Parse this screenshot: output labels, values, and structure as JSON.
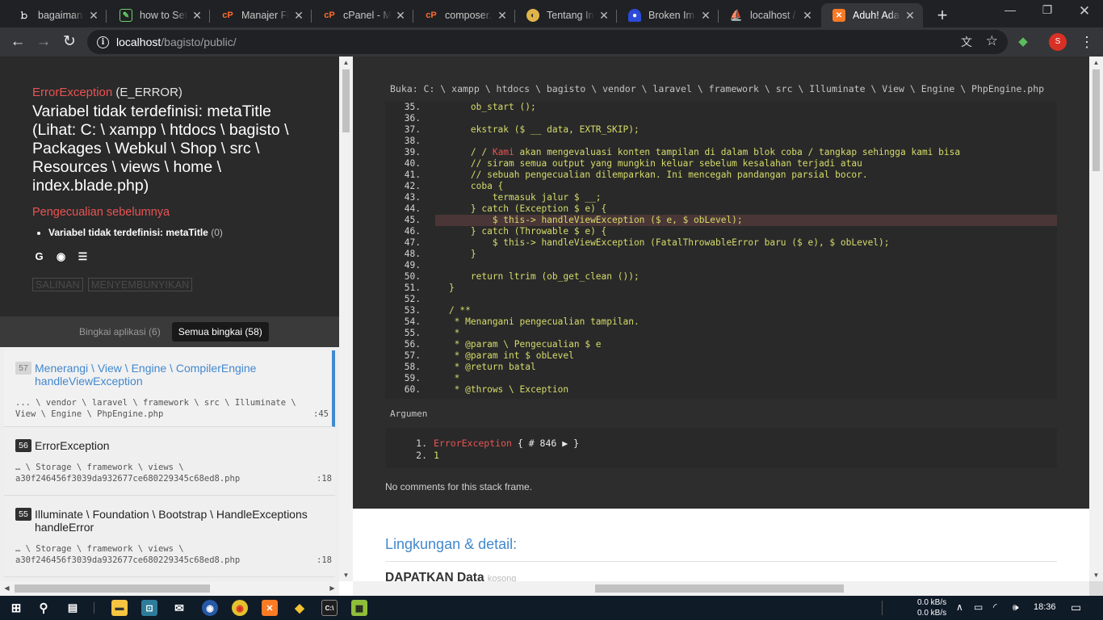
{
  "browser": {
    "tabs": [
      {
        "title": "bagaimana",
        "icon": "bing-icon"
      },
      {
        "title": "how to Setup",
        "icon": "document-icon"
      },
      {
        "title": "Manajer File",
        "icon": "cpanel-icon"
      },
      {
        "title": "cPanel - Ma",
        "icon": "cpanel-icon"
      },
      {
        "title": "composer.js",
        "icon": "cpanel-icon"
      },
      {
        "title": "Tentang Ind",
        "icon": "globe-icon"
      },
      {
        "title": "Broken Ima",
        "icon": "user-icon"
      },
      {
        "title": "localhost /",
        "icon": "phpmyadmin-icon"
      },
      {
        "title": "Aduh! Ada k",
        "icon": "xampp-icon",
        "active": true
      }
    ],
    "new_tab": "+",
    "url_host": "localhost",
    "url_path": "/bagisto/public/",
    "profile_initial": "S"
  },
  "exception": {
    "class_label": "ErrorException",
    "class_code": "(E_ERROR)",
    "message": "Variabel tidak terdefinisi: metaTitle (Lihat: C: \\ xampp \\ htdocs \\ bagisto \\ Packages \\ Webkul \\ Shop \\ src \\ Resources \\ views \\ home \\ index.blade.php)",
    "previous_title": "Pengecualian sebelumnya",
    "previous_item": "Variabel tidak terdefinisi: metaTitle",
    "previous_code": "(0)",
    "copy_button": "SALINAN",
    "hide_button": "MENYEMBUNYIKAN"
  },
  "frame_tabs": {
    "app": "Bingkai aplikasi (6)",
    "all": "Semua bingkai (58)"
  },
  "frames": [
    {
      "num": "57",
      "class": "Menerangi \\ View \\ Engine \\ CompilerEngine handleViewException",
      "file": "... \\ vendor \\ laravel \\ framework \\ src \\ Illuminate \\ View \\ Engine \\ PhpEngine.php",
      "line": ":45",
      "active": true
    },
    {
      "num": "56",
      "class": "ErrorException",
      "file": "… \\ Storage \\ framework \\ views \\ a30f246456f3039da932677ce680229345c68ed8.php",
      "line": ":18"
    },
    {
      "num": "55",
      "class": "Illuminate \\ Foundation \\ Bootstrap \\ HandleExceptions handleError",
      "file": "… \\ Storage \\ framework \\ views \\ a30f246456f3039da932677ce680229345c68ed8.php",
      "line": ":18"
    }
  ],
  "code": {
    "file_path": "Buka: C: \\ xampp \\ htdocs \\ bagisto \\ vendor \\ laravel \\ framework \\ src \\ Illuminate \\ View \\ Engine \\ PhpEngine.php",
    "lines": [
      {
        "n": "35.",
        "t": "        ob_start ();"
      },
      {
        "n": "36.",
        "t": ""
      },
      {
        "n": "37.",
        "t": "        ekstrak ($ __ data, EXTR_SKIP);"
      },
      {
        "n": "38.",
        "t": ""
      },
      {
        "n": "39.",
        "t": "        / / Kami akan mengevaluasi konten tampilan di dalam blok coba / tangkap sehingga kami bisa"
      },
      {
        "n": "40.",
        "t": "        // siram semua output yang mungkin keluar sebelum kesalahan terjadi atau"
      },
      {
        "n": "41.",
        "t": "        // sebuah pengecualian dilemparkan. Ini mencegah pandangan parsial bocor."
      },
      {
        "n": "42.",
        "t": "        coba {"
      },
      {
        "n": "43.",
        "t": "            termasuk jalur $ __;"
      },
      {
        "n": "44.",
        "t": "        } catch (Exception $ e) {"
      },
      {
        "n": "45.",
        "t": "            $ this-> handleViewException ($ e, $ obLevel);",
        "hl": true
      },
      {
        "n": "46.",
        "t": "        } catch (Throwable $ e) {"
      },
      {
        "n": "47.",
        "t": "            $ this-> handleViewException (FatalThrowableError baru ($ e), $ obLevel);"
      },
      {
        "n": "48.",
        "t": "        }"
      },
      {
        "n": "49.",
        "t": ""
      },
      {
        "n": "50.",
        "t": "        return ltrim (ob_get_clean ());"
      },
      {
        "n": "51.",
        "t": "    }"
      },
      {
        "n": "52.",
        "t": ""
      },
      {
        "n": "53.",
        "t": "    / **"
      },
      {
        "n": "54.",
        "t": "     * Menangani pengecualian tampilan."
      },
      {
        "n": "55.",
        "t": "     *"
      },
      {
        "n": "56.",
        "t": "     * @param \\ Pengecualian $ e"
      },
      {
        "n": "57.",
        "t": "     * @param int $ obLevel"
      },
      {
        "n": "58.",
        "t": "     * @return batal"
      },
      {
        "n": "59.",
        "t": "     *"
      },
      {
        "n": "60.",
        "t": "     * @throws \\ Exception"
      }
    ]
  },
  "arguments": {
    "label": "Argumen",
    "items": [
      {
        "n": "1.",
        "class": "ErrorException",
        "rest": " { # 846 ▶ }"
      },
      {
        "n": "2.",
        "value": "1"
      }
    ]
  },
  "comments": "No comments for this stack frame.",
  "env": {
    "title": "Lingkungan & detail:",
    "get_title": "DAPATKAN Data",
    "get_empty": "kosong"
  },
  "taskbar": {
    "net_up": "0.0 kB/s",
    "net_down": "0.0 kB/s",
    "time": "18:36"
  },
  "colors": {
    "accent_blue": "#4288ce",
    "error_red": "#e95353",
    "code_yellow": "#d6dc6a"
  }
}
